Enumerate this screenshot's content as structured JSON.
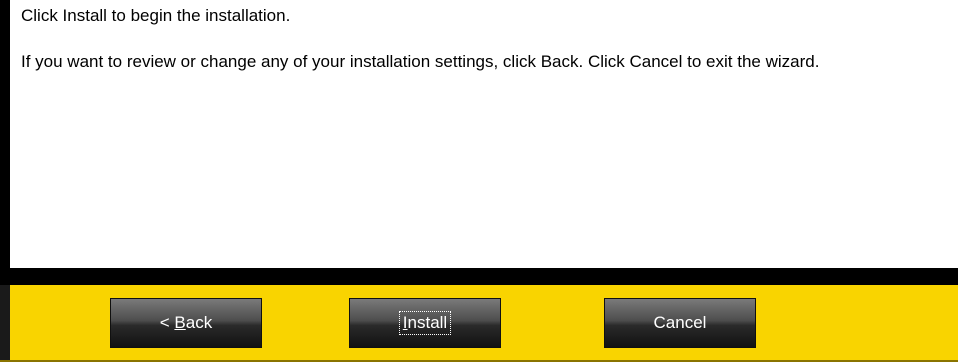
{
  "content": {
    "line1": "Click Install to begin the installation.",
    "line2": "If you want to review or change any of your installation settings, click Back. Click Cancel to exit the wizard."
  },
  "buttons": {
    "back": {
      "prefix": "< ",
      "mnemonic": "B",
      "rest": "ack"
    },
    "install": {
      "mnemonic": "I",
      "rest": "nstall"
    },
    "cancel": {
      "label": "Cancel"
    }
  },
  "colors": {
    "footer_background": "#f9d400",
    "band": "#000000",
    "button_top": "#7a7a7a",
    "button_bottom": "#121212"
  }
}
